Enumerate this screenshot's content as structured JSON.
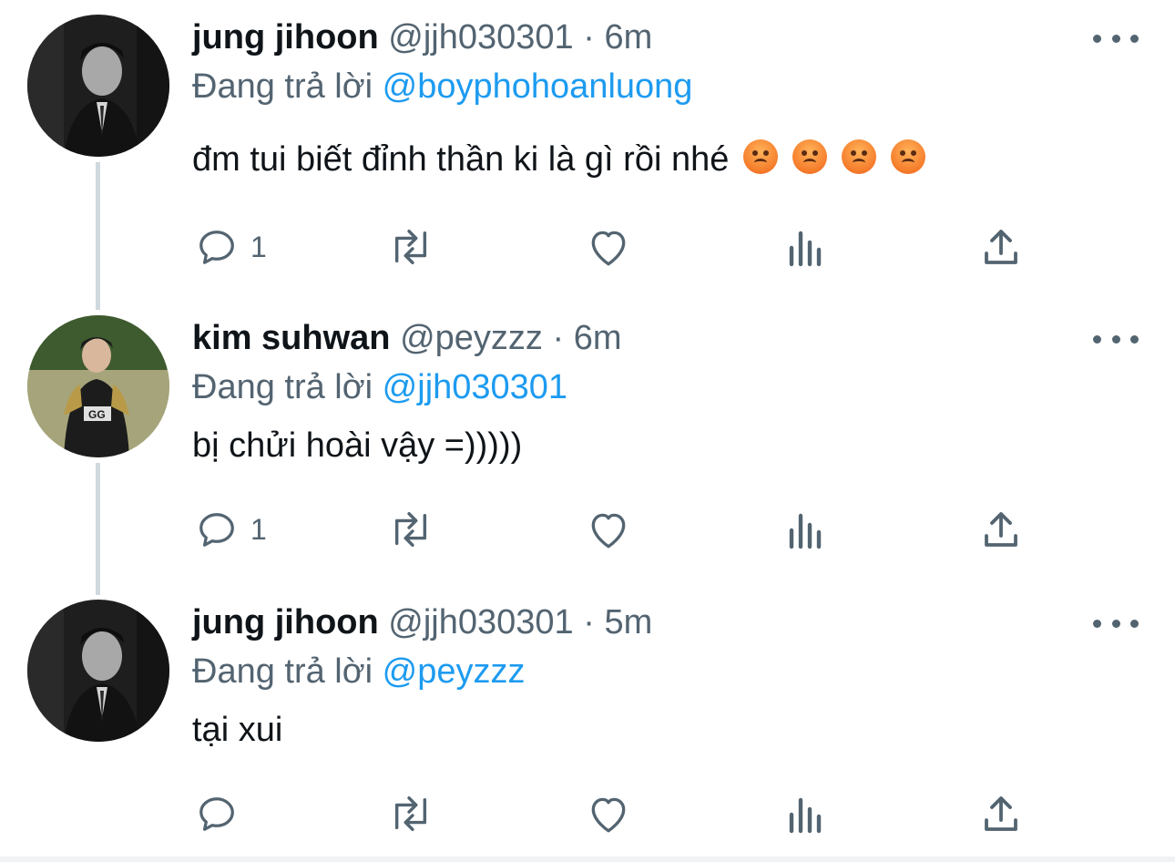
{
  "tweets": [
    {
      "display_name": "jung jihoon",
      "handle": "@jjh030301",
      "separator": "·",
      "time": "6m",
      "replying_prefix": "Đang trả lời",
      "replying_to": "@boyphohoanluong",
      "text": "đm tui biết đỉnh thần ki là gì rồi nhé",
      "emojis": [
        "angry-face-emoji",
        "angry-face-emoji",
        "angry-face-emoji",
        "angry-face-emoji"
      ],
      "reply_count": "1"
    },
    {
      "display_name": "kim suhwan",
      "handle": "@peyzzz",
      "separator": "·",
      "time": "6m",
      "replying_prefix": "Đang trả lời",
      "replying_to": "@jjh030301",
      "text": "bị chửi hoài vậy =)))))",
      "emojis": [],
      "reply_count": "1"
    },
    {
      "display_name": "jung jihoon",
      "handle": "@jjh030301",
      "separator": "·",
      "time": "5m",
      "replying_prefix": "Đang trả lời",
      "replying_to": "@peyzzz",
      "text": "tại xui",
      "emojis": [],
      "reply_count": ""
    }
  ],
  "icons": {
    "reply": "speech-bubble-icon",
    "retweet": "retweet-arrows-icon",
    "like": "heart-icon",
    "views": "bar-chart-icon",
    "share": "share-upload-icon",
    "more": "ellipsis-icon"
  },
  "colors": {
    "text_primary": "#0f1419",
    "text_secondary": "#536471",
    "mention": "#1d9bf0",
    "thread_line": "#cfd9de"
  }
}
